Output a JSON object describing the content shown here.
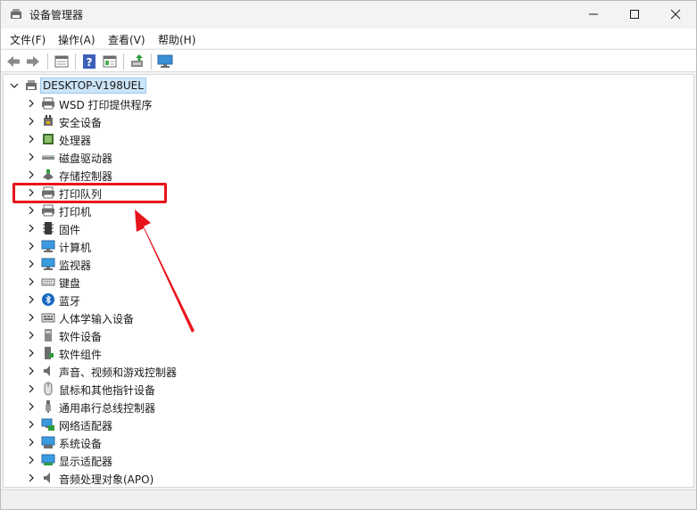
{
  "window": {
    "title": "设备管理器",
    "minimize_glyph": "—",
    "maximize_glyph": "□",
    "close_glyph": "✕"
  },
  "menu": {
    "items": [
      "文件(F)",
      "操作(A)",
      "查看(V)",
      "帮助(H)"
    ]
  },
  "toolbar": {
    "buttons": [
      "back-icon",
      "forward-icon",
      "properties-icon",
      "help-icon",
      "view-icon",
      "update-driver-icon",
      "monitor-icon"
    ]
  },
  "tree": {
    "root": "DESKTOP-V198UEL",
    "items": [
      {
        "label": "WSD 打印提供程序",
        "icon": "printer-icon"
      },
      {
        "label": "安全设备",
        "icon": "security-device-icon"
      },
      {
        "label": "处理器",
        "icon": "processor-icon"
      },
      {
        "label": "磁盘驱动器",
        "icon": "disk-drive-icon"
      },
      {
        "label": "存储控制器",
        "icon": "storage-controller-icon"
      },
      {
        "label": "打印队列",
        "icon": "printer-icon"
      },
      {
        "label": "打印机",
        "icon": "printer-icon"
      },
      {
        "label": "固件",
        "icon": "firmware-icon"
      },
      {
        "label": "计算机",
        "icon": "computer-icon"
      },
      {
        "label": "监视器",
        "icon": "monitor-icon"
      },
      {
        "label": "键盘",
        "icon": "keyboard-icon"
      },
      {
        "label": "蓝牙",
        "icon": "bluetooth-icon"
      },
      {
        "label": "人体学输入设备",
        "icon": "hid-icon"
      },
      {
        "label": "软件设备",
        "icon": "software-device-icon"
      },
      {
        "label": "软件组件",
        "icon": "software-component-icon"
      },
      {
        "label": "声音、视频和游戏控制器",
        "icon": "speaker-icon"
      },
      {
        "label": "鼠标和其他指针设备",
        "icon": "mouse-icon"
      },
      {
        "label": "通用串行总线控制器",
        "icon": "usb-icon"
      },
      {
        "label": "网络适配器",
        "icon": "network-adapter-icon"
      },
      {
        "label": "系统设备",
        "icon": "system-device-icon"
      },
      {
        "label": "显示适配器",
        "icon": "display-adapter-icon"
      },
      {
        "label": "音频处理对象(APO)",
        "icon": "speaker-icon"
      }
    ]
  },
  "colors": {
    "highlight": "#e8141c",
    "selection": "#cce4f7"
  }
}
